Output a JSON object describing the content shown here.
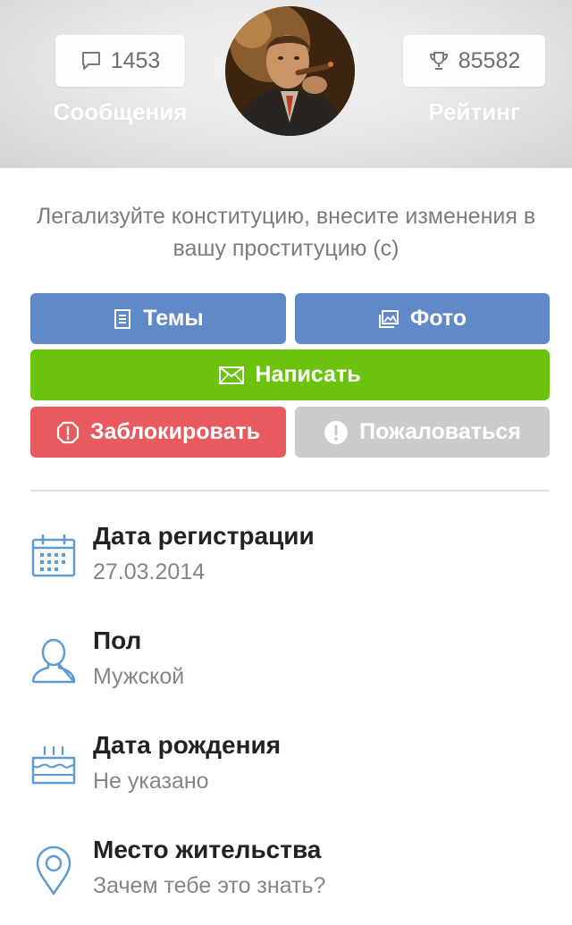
{
  "header": {
    "messages": {
      "count": "1453",
      "label": "Сообщения",
      "icon": "speech-bubble-icon"
    },
    "rating": {
      "count": "85582",
      "label": "Рейтинг",
      "icon": "trophy-icon"
    }
  },
  "status_text": "Легализуйте конституцию, внесите изменения в вашу проституцию (с)",
  "buttons": {
    "topics": "Темы",
    "photos": "Фото",
    "write": "Написать",
    "block": "Заблокировать",
    "report": "Пожаловаться"
  },
  "info": [
    {
      "title": "Дата регистрации",
      "value": "27.03.2014",
      "icon": "calendar-icon"
    },
    {
      "title": "Пол",
      "value": "Мужской",
      "icon": "person-icon"
    },
    {
      "title": "Дата рождения",
      "value": "Не указано",
      "icon": "cake-icon"
    },
    {
      "title": "Место жительства",
      "value": "Зачем тебе это знать?",
      "icon": "location-pin-icon"
    }
  ],
  "colors": {
    "blue": "#6089c8",
    "green": "#6cc30e",
    "red": "#e85a5e",
    "gray": "#cbcbcb",
    "icon_blue": "#5d9bd6"
  }
}
